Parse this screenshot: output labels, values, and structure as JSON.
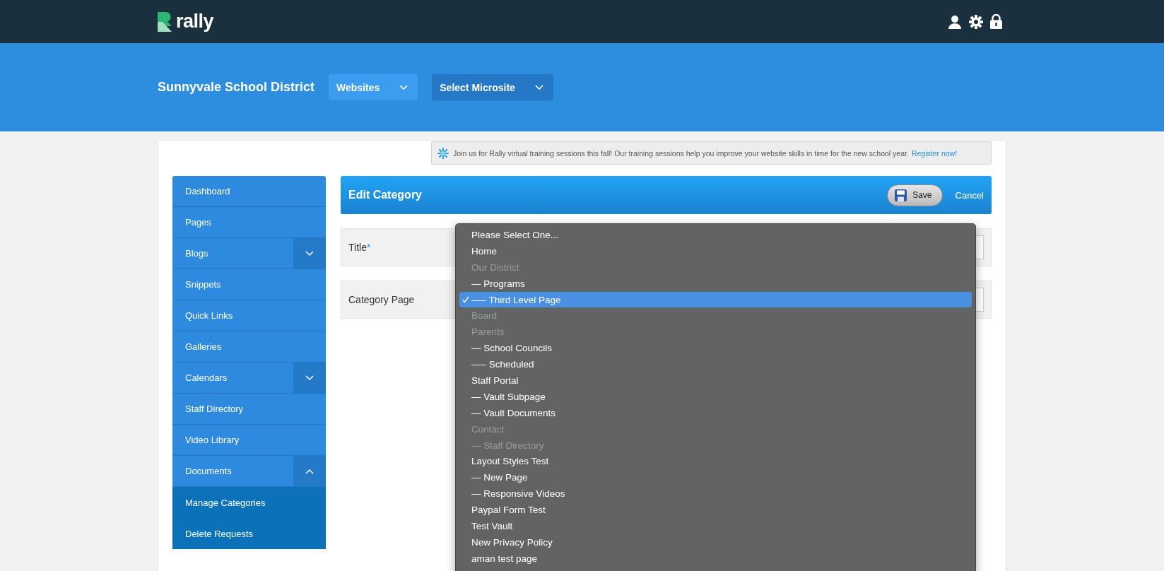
{
  "brand": {
    "name": "rally"
  },
  "site_bar": {
    "title": "Sunnyvale School District",
    "menus": [
      {
        "label": "Websites",
        "kind": "light"
      },
      {
        "label": "Select Microsite",
        "kind": "dark"
      }
    ]
  },
  "notice": {
    "text": "Join us for Rally virtual training sessions this fall! Our training sessions help you improve your website skills in time for the new school year.",
    "link": "Register now!"
  },
  "sidebar": {
    "items": [
      {
        "label": "Dashboard",
        "kind": "link"
      },
      {
        "label": "Pages",
        "kind": "link"
      },
      {
        "label": "Blogs",
        "kind": "group",
        "expanded": false
      },
      {
        "label": "Snippets",
        "kind": "link"
      },
      {
        "label": "Quick Links",
        "kind": "link"
      },
      {
        "label": "Galleries",
        "kind": "link"
      },
      {
        "label": "Calendars",
        "kind": "group",
        "expanded": false
      },
      {
        "label": "Staff Directory",
        "kind": "link"
      },
      {
        "label": "Video Library",
        "kind": "link"
      },
      {
        "label": "Documents",
        "kind": "group",
        "expanded": true,
        "children": [
          {
            "label": "Manage Categories"
          },
          {
            "label": "Delete Requests"
          }
        ]
      }
    ]
  },
  "panel": {
    "title": "Edit Category",
    "save": "Save",
    "cancel": "Cancel"
  },
  "form": {
    "fields": [
      {
        "label": "Title",
        "required_mark": "*"
      },
      {
        "label": "Category Page"
      }
    ]
  },
  "dropdown": {
    "options": [
      {
        "label": "Please Select One...",
        "disabled": false,
        "selected": false
      },
      {
        "label": "Home",
        "disabled": false,
        "selected": false
      },
      {
        "label": "Our District",
        "disabled": true,
        "selected": false
      },
      {
        "label": "— Programs",
        "disabled": false,
        "selected": false
      },
      {
        "label": "—– Third Level Page",
        "disabled": false,
        "selected": true
      },
      {
        "label": "Board",
        "disabled": true,
        "selected": false
      },
      {
        "label": "Parents",
        "disabled": true,
        "selected": false
      },
      {
        "label": "— School Councils",
        "disabled": false,
        "selected": false
      },
      {
        "label": "—– Scheduled",
        "disabled": false,
        "selected": false
      },
      {
        "label": "Staff Portal",
        "disabled": false,
        "selected": false
      },
      {
        "label": "— Vault Subpage",
        "disabled": false,
        "selected": false
      },
      {
        "label": "— Vault Documents",
        "disabled": false,
        "selected": false
      },
      {
        "label": "Contact",
        "disabled": true,
        "selected": false
      },
      {
        "label": "— Staff Directory",
        "disabled": true,
        "selected": false
      },
      {
        "label": "Layout Styles Test",
        "disabled": false,
        "selected": false
      },
      {
        "label": "— New Page",
        "disabled": false,
        "selected": false
      },
      {
        "label": "— Responsive Videos",
        "disabled": false,
        "selected": false
      },
      {
        "label": "Paypal Form Test",
        "disabled": false,
        "selected": false
      },
      {
        "label": "Test Vault",
        "disabled": false,
        "selected": false
      },
      {
        "label": "New Privacy Policy",
        "disabled": false,
        "selected": false
      },
      {
        "label": "aman test page",
        "disabled": false,
        "selected": false
      }
    ]
  }
}
